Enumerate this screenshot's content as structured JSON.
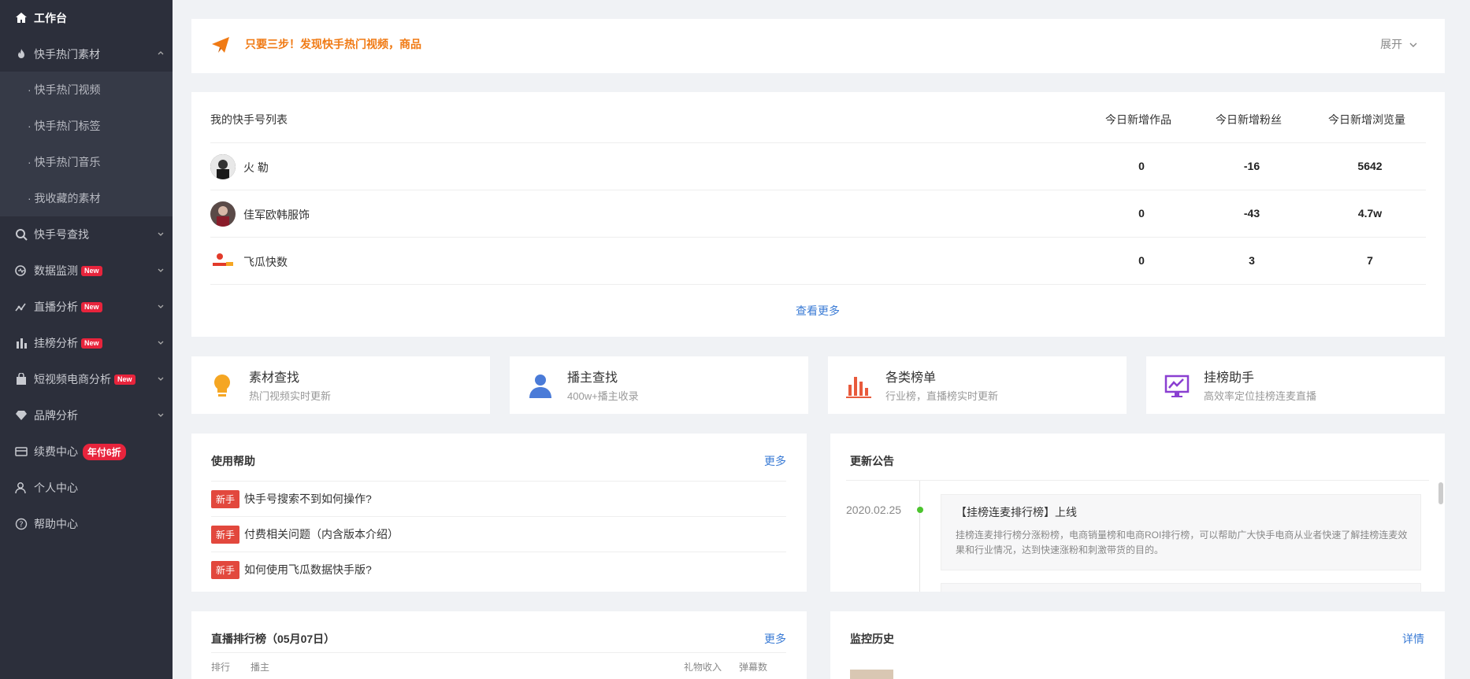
{
  "sidebar": {
    "items": [
      {
        "label": "工作台",
        "icon": "home-icon",
        "active": true
      },
      {
        "label": "快手热门素材",
        "icon": "fire-icon",
        "expanded": true
      },
      {
        "label": "快手号查找",
        "icon": "search-icon"
      },
      {
        "label": "数据监测",
        "icon": "monitor-icon",
        "badge": "New"
      },
      {
        "label": "直播分析",
        "icon": "line-chart-icon",
        "badge": "New"
      },
      {
        "label": "挂榜分析",
        "icon": "bar-chart-icon",
        "badge": "New"
      },
      {
        "label": "短视频电商分析",
        "icon": "shopping-bag-icon",
        "badge": "New"
      },
      {
        "label": "品牌分析",
        "icon": "diamond-icon"
      },
      {
        "label": "续费中心",
        "icon": "card-icon",
        "promo": "年付6折"
      },
      {
        "label": "个人中心",
        "icon": "user-icon"
      },
      {
        "label": "帮助中心",
        "icon": "question-icon"
      }
    ],
    "subitems": [
      "· 快手热门视频",
      "· 快手热门标签",
      "· 快手热门音乐",
      "· 我收藏的素材"
    ]
  },
  "tip": {
    "text": "只要三步！发现快手热门视频，商品",
    "expand_label": "展开"
  },
  "account_table": {
    "title": "我的快手号列表",
    "columns": [
      "今日新增作品",
      "今日新增粉丝",
      "今日新增浏览量"
    ],
    "rows": [
      {
        "name": "火 勒",
        "works": "0",
        "fans": "-16",
        "views": "5642"
      },
      {
        "name": "佳军欧韩服饰",
        "works": "0",
        "fans": "-43",
        "views": "4.7w"
      },
      {
        "name": "飞瓜快数",
        "works": "0",
        "fans": "3",
        "views": "7"
      }
    ],
    "more": "查看更多"
  },
  "features": [
    {
      "title": "素材查找",
      "sub": "热门视频实时更新",
      "icon": "bulb-icon",
      "color": "#f5a623"
    },
    {
      "title": "播主查找",
      "sub": "400w+播主收录",
      "icon": "person-icon",
      "color": "#4a7bd8"
    },
    {
      "title": "各类榜单",
      "sub": "行业榜，直播榜实时更新",
      "icon": "ranking-icon",
      "color": "#e85a3c"
    },
    {
      "title": "挂榜助手",
      "sub": "高效率定位挂榜连麦直播",
      "icon": "trend-icon",
      "color": "#8a3fd1"
    }
  ],
  "help": {
    "title": "使用帮助",
    "more": "更多",
    "tag": "新手",
    "items": [
      "快手号搜索不到如何操作?",
      "付费相关问题（内含版本介绍）",
      "如何使用飞瓜数据快手版?"
    ]
  },
  "announce": {
    "title": "更新公告",
    "date": "2020.02.25",
    "headline": "【挂榜连麦排行榜】上线",
    "desc": "挂榜连麦排行榜分涨粉榜，电商销量榜和电商ROI排行榜，可以帮助广大快手电商从业者快速了解挂榜连麦效果和行业情况，达到快速涨粉和刺激带货的目的。"
  },
  "live_rank": {
    "title": "直播排行榜（05月07日）",
    "more": "更多",
    "cols": [
      "排行",
      "播主",
      "礼物收入",
      "弹幕数"
    ]
  },
  "monitor": {
    "title": "监控历史",
    "more": "详情"
  }
}
